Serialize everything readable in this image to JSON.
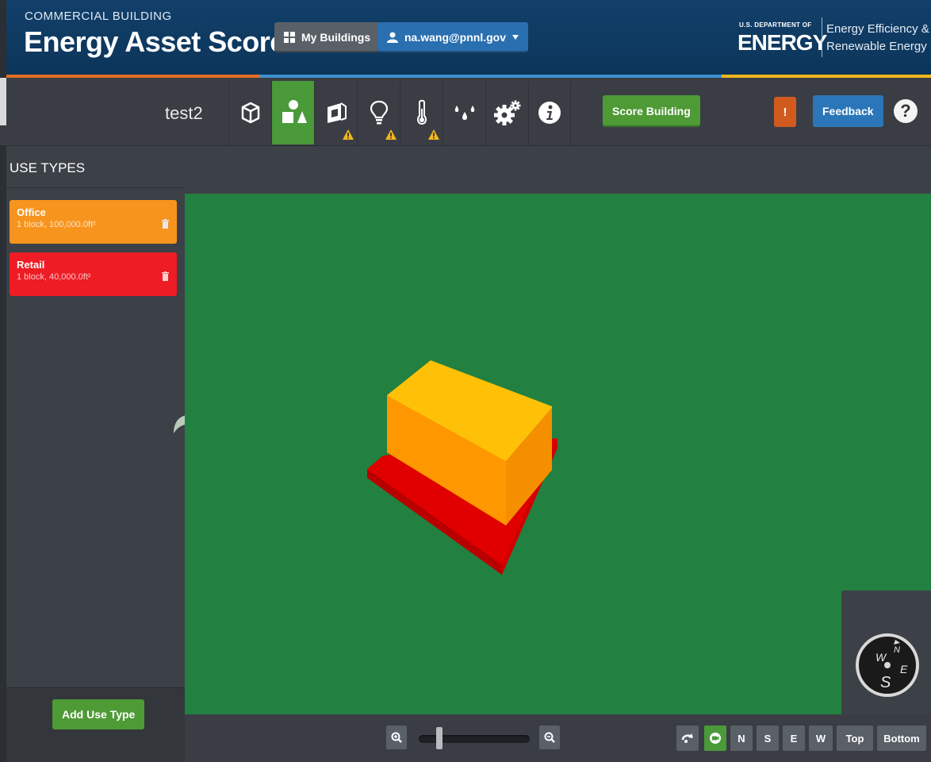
{
  "header": {
    "brand_small": "COMMERCIAL BUILDING",
    "brand_big": "Energy Asset Score",
    "my_buildings_label": "My Buildings",
    "account_label": "na.wang@pnnl.gov",
    "doe_small": "U.S. DEPARTMENT OF",
    "doe_big": "ENERGY",
    "eere_line1": "Energy Efficiency &",
    "eere_line2": "Renewable Energy"
  },
  "toolbar": {
    "building_name": "test2",
    "tabs": [
      {
        "name": "geometry",
        "icon": "box-icon",
        "active": false,
        "warning": false
      },
      {
        "name": "use-types",
        "icon": "shapes-icon",
        "active": true,
        "warning": false
      },
      {
        "name": "envelope",
        "icon": "window-icon",
        "active": false,
        "warning": true
      },
      {
        "name": "lighting",
        "icon": "lightbulb-icon",
        "active": false,
        "warning": true
      },
      {
        "name": "hvac",
        "icon": "thermometer-icon",
        "active": false,
        "warning": true
      },
      {
        "name": "water",
        "icon": "water-drops-icon",
        "active": false,
        "warning": false
      },
      {
        "name": "systems",
        "icon": "gears-icon",
        "active": false,
        "warning": false
      },
      {
        "name": "info",
        "icon": "info-icon",
        "active": false,
        "warning": false
      }
    ],
    "score_label": "Score Building",
    "alert_label": "!",
    "feedback_label": "Feedback",
    "help_label": "?"
  },
  "sidebar": {
    "title": "USE TYPES",
    "use_types": [
      {
        "name": "Office",
        "info": "1 block, 100,000.0ft²",
        "color": "#f7941d"
      },
      {
        "name": "Retail",
        "info": "1 block, 40,000.0ft²",
        "color": "#ee1c24"
      }
    ],
    "add_label": "Add Use Type"
  },
  "viewer": {
    "background_color": "#228040",
    "compass_labels": {
      "n": "N",
      "s": "S",
      "e": "E",
      "w": "W"
    },
    "view_buttons": [
      "N",
      "S",
      "E",
      "W",
      "Top",
      "Bottom"
    ]
  }
}
